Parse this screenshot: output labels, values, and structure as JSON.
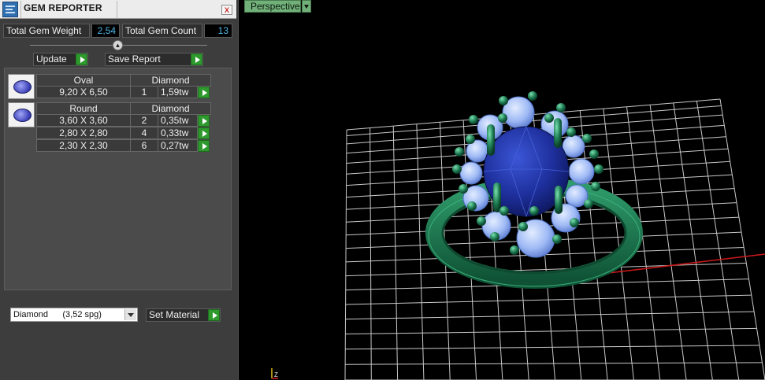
{
  "panel": {
    "title": "GEM REPORTER",
    "close_label": "x",
    "total_weight_label": "Total Gem Weight",
    "total_weight_value": "2,54",
    "total_count_label": "Total Gem Count",
    "total_count_value": "13",
    "update_label": "Update",
    "save_report_label": "Save Report",
    "gem_groups": [
      {
        "shape": "Oval",
        "material": "Diamond",
        "rows": [
          {
            "size": "9,20 X 6,50",
            "count": "1",
            "weight": "1,59tw"
          }
        ]
      },
      {
        "shape": "Round",
        "material": "Diamond",
        "rows": [
          {
            "size": "3,60 X 3,60",
            "count": "2",
            "weight": "0,35tw"
          },
          {
            "size": "2,80 X 2,80",
            "count": "4",
            "weight": "0,33tw"
          },
          {
            "size": "2,30 X 2,30",
            "count": "6",
            "weight": "0,27tw"
          }
        ]
      }
    ],
    "material_select_value": "Diamond      (3,52 spg)",
    "set_material_label": "Set Material"
  },
  "viewport": {
    "view_label": "Perspective",
    "gizmo_label": "Z"
  },
  "colors": {
    "arrow_green": "#2e9a2e",
    "value_cyan": "#4fb7e8",
    "ring_green": "#1d7a52",
    "sapphire": "#1e2f9c",
    "diamond_blue": "#a9c8ff",
    "x_axis_red": "#d01818"
  },
  "icons": [
    "gem-reporter-app-icon",
    "close-icon",
    "collapse-arrow-icon",
    "play-arrow-icon",
    "oval-gem-icon",
    "round-gem-icon",
    "dropdown-arrow-icon",
    "axis-gizmo-icon"
  ]
}
